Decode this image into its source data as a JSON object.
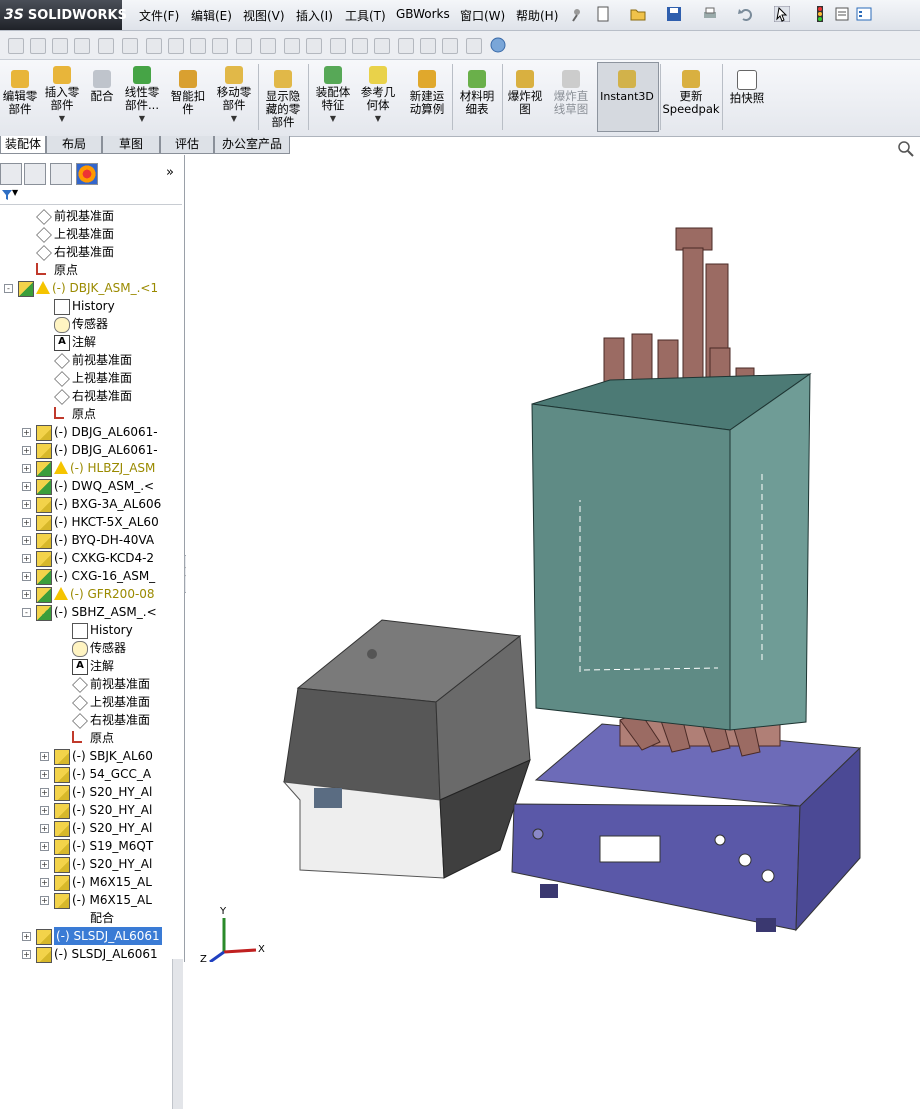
{
  "app": {
    "logo_text": "SOLIDWORKS",
    "logo_prefix": "3S"
  },
  "menu": {
    "items": [
      "文件(F)",
      "编辑(E)",
      "视图(V)",
      "插入(I)",
      "工具(T)",
      "GBWorks",
      "窗口(W)",
      "帮助(H)"
    ]
  },
  "commands": [
    {
      "label": "编辑零\n部件"
    },
    {
      "label": "插入零\n部件"
    },
    {
      "label": "配合"
    },
    {
      "label": "线性零\n部件..."
    },
    {
      "label": "智能扣\n件"
    },
    {
      "label": "移动零\n部件"
    },
    {
      "label": "显示隐\n藏的零\n部件"
    },
    {
      "label": "装配体\n特征"
    },
    {
      "label": "参考几\n何体"
    },
    {
      "label": "新建运\n动算例"
    },
    {
      "label": "材料明\n细表"
    },
    {
      "label": "爆炸视\n图"
    },
    {
      "label": "爆炸直\n线草图"
    },
    {
      "label": "Instant3D"
    },
    {
      "label": "更新\nSpeedpak"
    },
    {
      "label": "拍快照"
    }
  ],
  "tabs": [
    "装配体",
    "布局",
    "草图",
    "评估",
    "办公室产品"
  ],
  "tree": [
    {
      "label": "前视基准面",
      "icon": "plane-icon",
      "indent": 1
    },
    {
      "label": "上视基准面",
      "icon": "plane-icon",
      "indent": 1
    },
    {
      "label": "右视基准面",
      "icon": "plane-icon",
      "indent": 1
    },
    {
      "label": "原点",
      "icon": "origin-icon",
      "indent": 1
    },
    {
      "label": "(-) DBJK_ASM_.<1",
      "icon": "assembly-icon",
      "indent": 0,
      "warn": true,
      "expand": "-"
    },
    {
      "label": "History",
      "icon": "history-icon",
      "indent": 2
    },
    {
      "label": "传感器",
      "icon": "sensor-icon",
      "indent": 2
    },
    {
      "label": "注解",
      "icon": "annotation-icon",
      "indent": 2
    },
    {
      "label": "前视基准面",
      "icon": "plane-icon",
      "indent": 2
    },
    {
      "label": "上视基准面",
      "icon": "plane-icon",
      "indent": 2
    },
    {
      "label": "右视基准面",
      "icon": "plane-icon",
      "indent": 2
    },
    {
      "label": "原点",
      "icon": "origin-icon",
      "indent": 2
    },
    {
      "label": "(-) DBJG_AL6061-",
      "icon": "part-icon",
      "indent": 1,
      "expand": "+"
    },
    {
      "label": "(-) DBJG_AL6061-",
      "icon": "part-icon",
      "indent": 1,
      "expand": "+"
    },
    {
      "label": "(-) HLBZJ_ASM",
      "icon": "assembly-icon",
      "indent": 1,
      "expand": "+",
      "warn": true
    },
    {
      "label": "(-) DWQ_ASM_.<",
      "icon": "assembly-icon",
      "indent": 1,
      "expand": "+"
    },
    {
      "label": "(-) BXG-3A_AL606",
      "icon": "part-icon",
      "indent": 1,
      "expand": "+"
    },
    {
      "label": "(-) HKCT-5X_AL60",
      "icon": "part-icon",
      "indent": 1,
      "expand": "+"
    },
    {
      "label": "(-) BYQ-DH-40VA",
      "icon": "part-icon",
      "indent": 1,
      "expand": "+"
    },
    {
      "label": "(-) CXKG-KCD4-2",
      "icon": "part-icon",
      "indent": 1,
      "expand": "+"
    },
    {
      "label": "(-) CXG-16_ASM_",
      "icon": "assembly-icon",
      "indent": 1,
      "expand": "+"
    },
    {
      "label": "(-) GFR200-08",
      "icon": "assembly-icon",
      "indent": 1,
      "expand": "+",
      "warn": true
    },
    {
      "label": "(-) SBHZ_ASM_.<",
      "icon": "assembly-icon",
      "indent": 1,
      "expand": "-"
    },
    {
      "label": "History",
      "icon": "history-icon",
      "indent": 3
    },
    {
      "label": "传感器",
      "icon": "sensor-icon",
      "indent": 3
    },
    {
      "label": "注解",
      "icon": "annotation-icon",
      "indent": 3
    },
    {
      "label": "前视基准面",
      "icon": "plane-icon",
      "indent": 3
    },
    {
      "label": "上视基准面",
      "icon": "plane-icon",
      "indent": 3
    },
    {
      "label": "右视基准面",
      "icon": "plane-icon",
      "indent": 3
    },
    {
      "label": "原点",
      "icon": "origin-icon",
      "indent": 3
    },
    {
      "label": "(-) SBJK_AL60",
      "icon": "part-icon",
      "indent": 2,
      "expand": "+"
    },
    {
      "label": "(-) 54_GCC_A",
      "icon": "part-icon",
      "indent": 2,
      "expand": "+"
    },
    {
      "label": "(-) S20_HY_Al",
      "icon": "part-icon",
      "indent": 2,
      "expand": "+"
    },
    {
      "label": "(-) S20_HY_Al",
      "icon": "part-icon",
      "indent": 2,
      "expand": "+"
    },
    {
      "label": "(-) S20_HY_Al",
      "icon": "part-icon",
      "indent": 2,
      "expand": "+"
    },
    {
      "label": "(-) S19_M6QT",
      "icon": "part-icon",
      "indent": 2,
      "expand": "+"
    },
    {
      "label": "(-) S20_HY_Al",
      "icon": "part-icon",
      "indent": 2,
      "expand": "+"
    },
    {
      "label": "(-) M6X15_AL",
      "icon": "part-icon",
      "indent": 2,
      "expand": "+"
    },
    {
      "label": "(-) M6X15_AL",
      "icon": "part-icon",
      "indent": 2,
      "expand": "+"
    },
    {
      "label": "配合",
      "icon": "mates-icon",
      "indent": 3
    },
    {
      "label": "(-) SLSDJ_AL6061",
      "icon": "part-icon",
      "indent": 1,
      "expand": "+",
      "selected": true
    },
    {
      "label": "(-) SLSDJ_AL6061",
      "icon": "part-icon",
      "indent": 1,
      "expand": "+"
    }
  ],
  "triad": {
    "x": "X",
    "y": "Y",
    "z": "Z"
  },
  "colors": {
    "cabinet": "#5f8b85",
    "base": "#5c5a9e",
    "cover": "#5a5a5a",
    "mechanism": "#9b6b63"
  }
}
